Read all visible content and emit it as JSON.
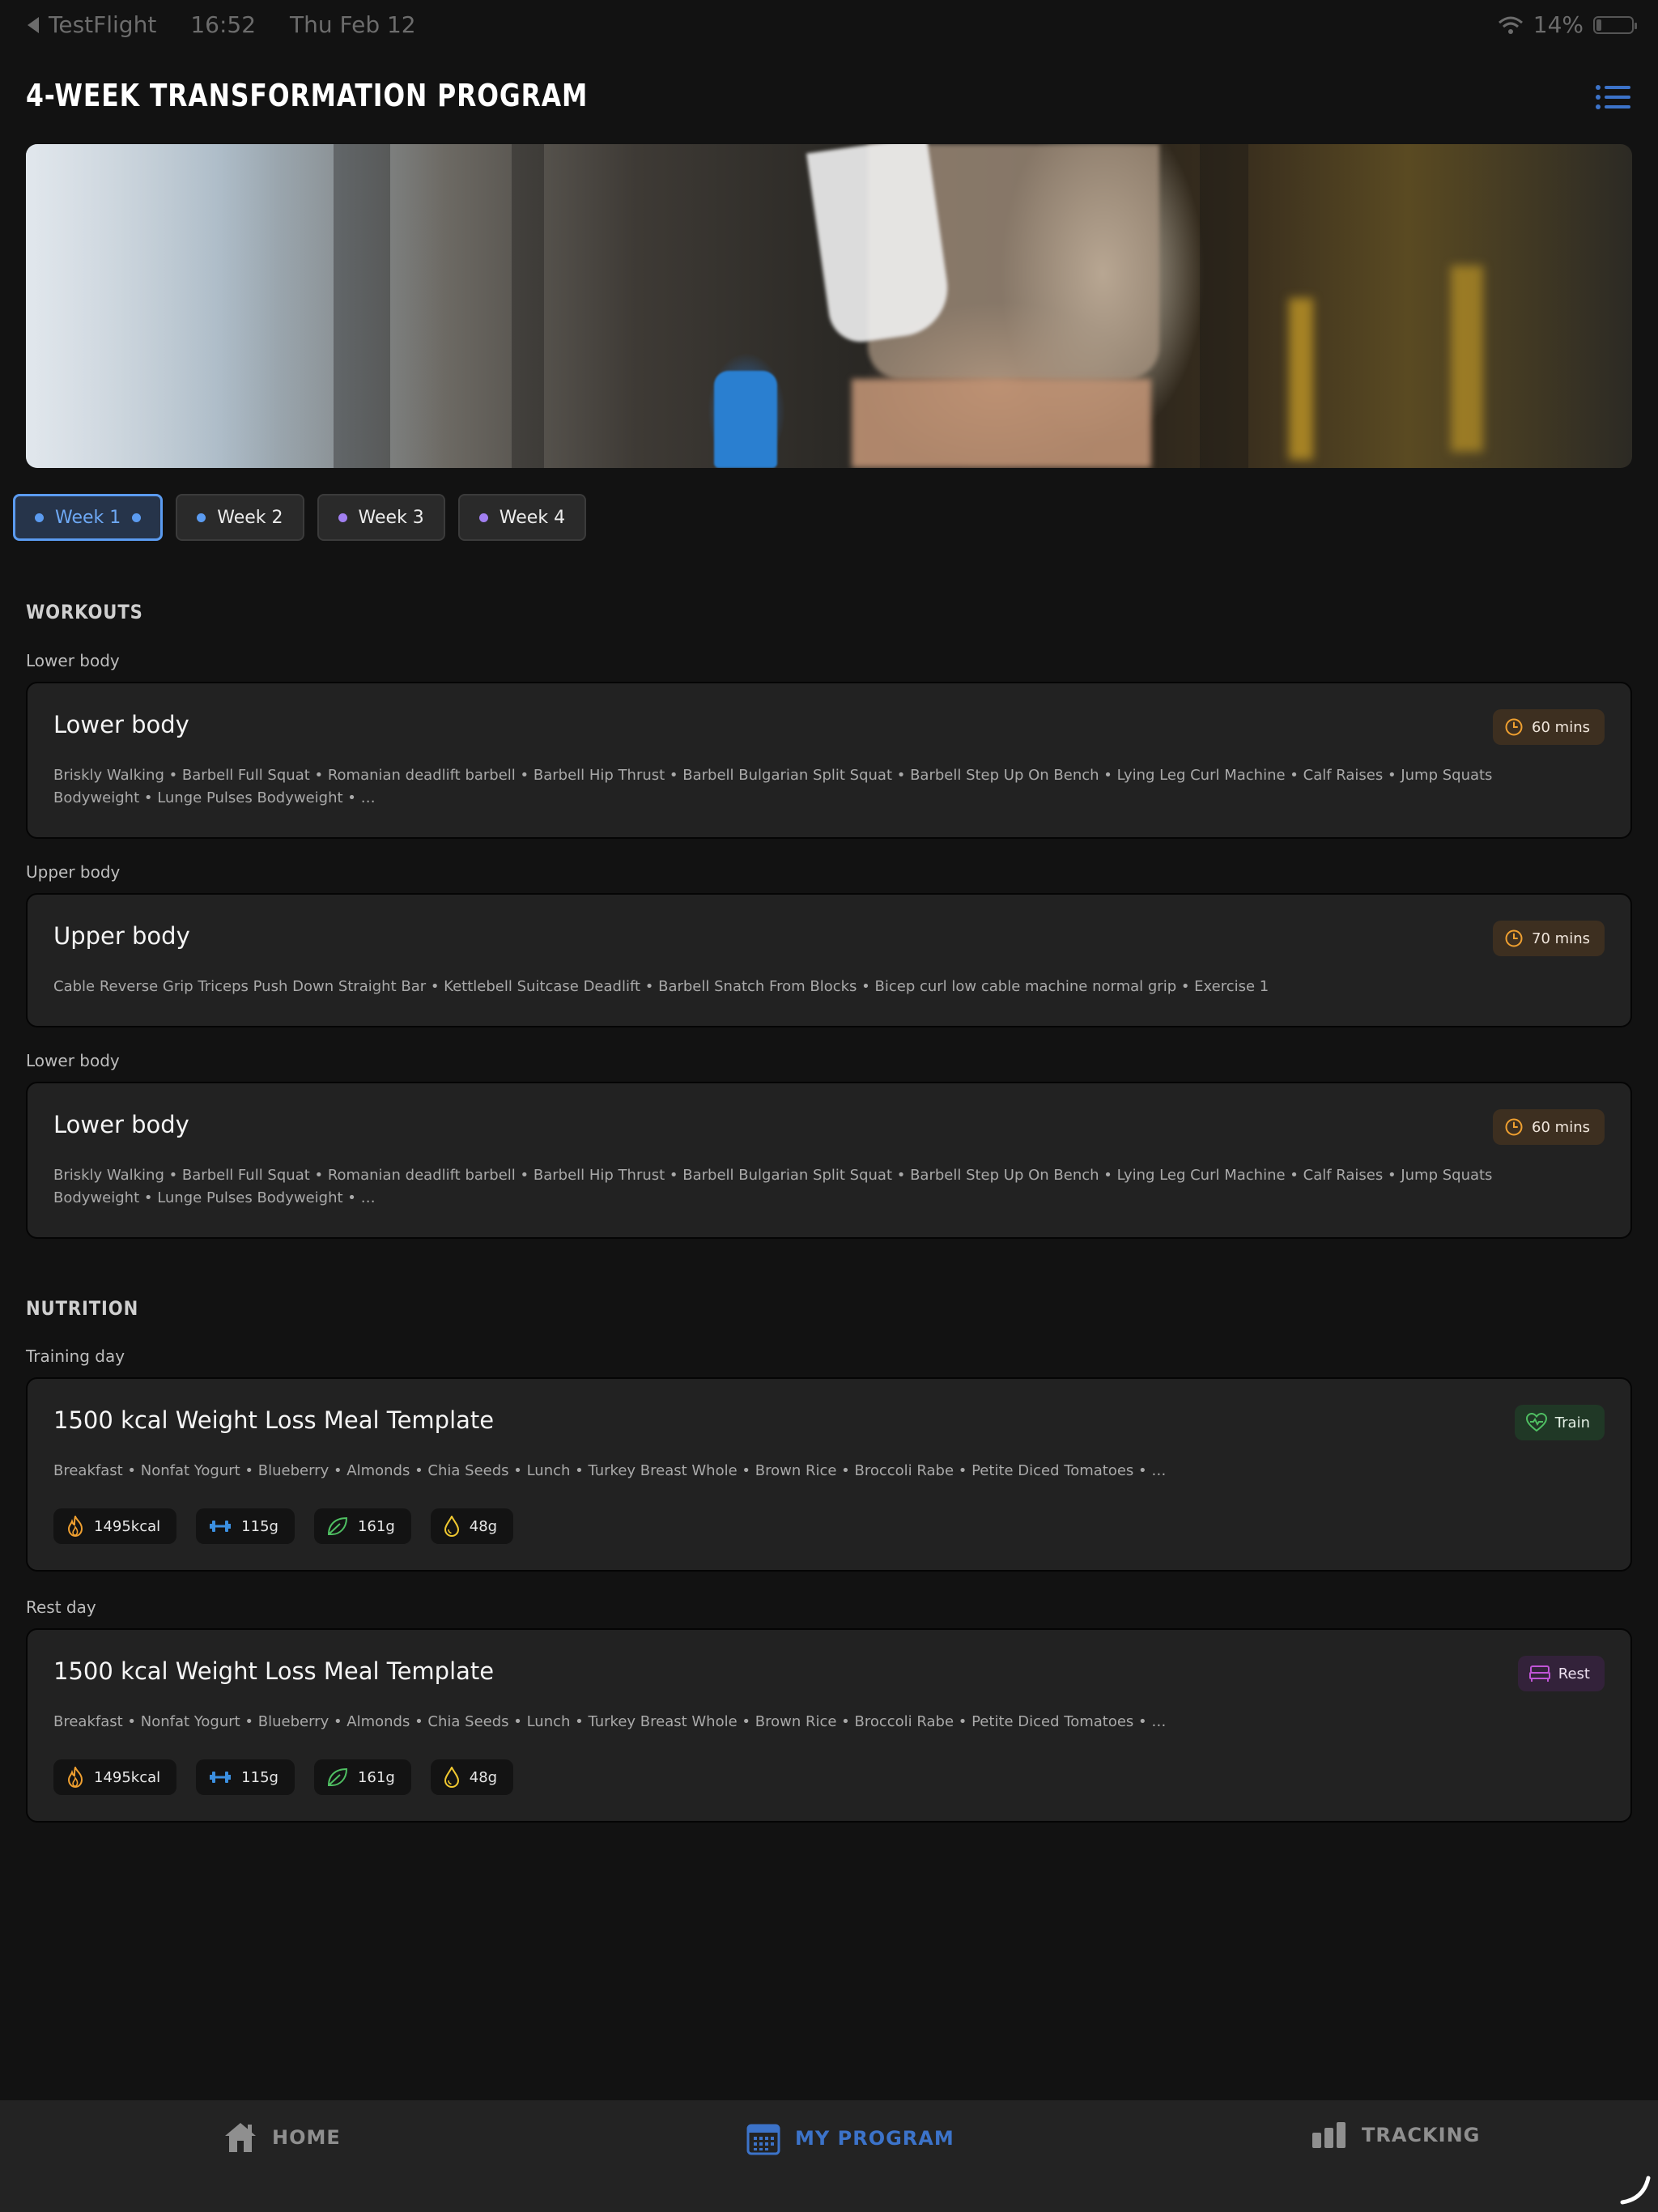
{
  "status_bar": {
    "back_app": "TestFlight",
    "time": "16:52",
    "date": "Thu Feb 12",
    "battery": "14%",
    "battery_level": 0.14
  },
  "header": {
    "title": "4-WEEK TRANSFORMATION PROGRAM",
    "menu_icon": "list-icon"
  },
  "week_tabs": [
    {
      "label": "Week 1",
      "active": true,
      "dot_color": "#5b9bf0"
    },
    {
      "label": "Week 2",
      "active": false,
      "dot_color": "#5b9bf0"
    },
    {
      "label": "Week 3",
      "active": false,
      "dot_color": "#a17ff0"
    },
    {
      "label": "Week 4",
      "active": false,
      "dot_color": "#a17ff0"
    }
  ],
  "workouts": {
    "title": "WORKOUTS",
    "items": [
      {
        "group": "Lower body",
        "title": "Lower body",
        "duration": "60 mins",
        "exercises": "Briskly Walking • Barbell Full Squat • Romanian deadlift barbell • Barbell Hip Thrust • Barbell Bulgarian Split Squat • Barbell Step Up On Bench • Lying Leg Curl Machine • Calf Raises • Jump Squats Bodyweight • Lunge Pulses Bodyweight • …"
      },
      {
        "group": "Upper body",
        "title": "Upper body",
        "duration": "70 mins",
        "exercises": "Cable Reverse Grip Triceps Push Down Straight Bar • Kettlebell Suitcase Deadlift • Barbell Snatch From Blocks • Bicep curl low cable machine normal grip • Exercise 1"
      },
      {
        "group": "Lower body",
        "title": "Lower body",
        "duration": "60 mins",
        "exercises": "Briskly Walking • Barbell Full Squat • Romanian deadlift barbell • Barbell Hip Thrust • Barbell Bulgarian Split Squat • Barbell Step Up On Bench • Lying Leg Curl Machine • Calf Raises • Jump Squats Bodyweight • Lunge Pulses Bodyweight • …"
      }
    ]
  },
  "nutrition": {
    "title": "NUTRITION",
    "items": [
      {
        "group": "Training day",
        "title": "1500 kcal Weight Loss Meal Template",
        "badge": "Train",
        "badge_icon": "heart-pulse-icon",
        "foods": "Breakfast • Nonfat Yogurt • Blueberry • Almonds • Chia Seeds • Lunch • Turkey Breast Whole • Brown Rice • Broccoli Rabe • Petite Diced Tomatoes • …",
        "macros": {
          "calories": "1495kcal",
          "protein": "115g",
          "carbs": "161g",
          "fat": "48g"
        }
      },
      {
        "group": "Rest day",
        "title": "1500 kcal Weight Loss Meal Template",
        "badge": "Rest",
        "badge_icon": "bed-icon",
        "foods": "Breakfast • Nonfat Yogurt • Blueberry • Almonds • Chia Seeds • Lunch • Turkey Breast Whole • Brown Rice • Broccoli Rabe • Petite Diced Tomatoes • …",
        "macros": {
          "calories": "1495kcal",
          "protein": "115g",
          "carbs": "161g",
          "fat": "48g"
        }
      }
    ]
  },
  "bottom_nav": [
    {
      "label": "HOME",
      "icon": "house-icon",
      "active": false
    },
    {
      "label": "MY PROGRAM",
      "icon": "calendar-icon",
      "active": true
    },
    {
      "label": "TRACKING",
      "icon": "bar-chart-icon",
      "active": false
    }
  ],
  "colors": {
    "accent": "#5b9bf0",
    "nav_active": "#3c73c9",
    "time_orange": "#f0a030",
    "train_green": "#4fbf62",
    "rest_purple": "#c054d6"
  }
}
